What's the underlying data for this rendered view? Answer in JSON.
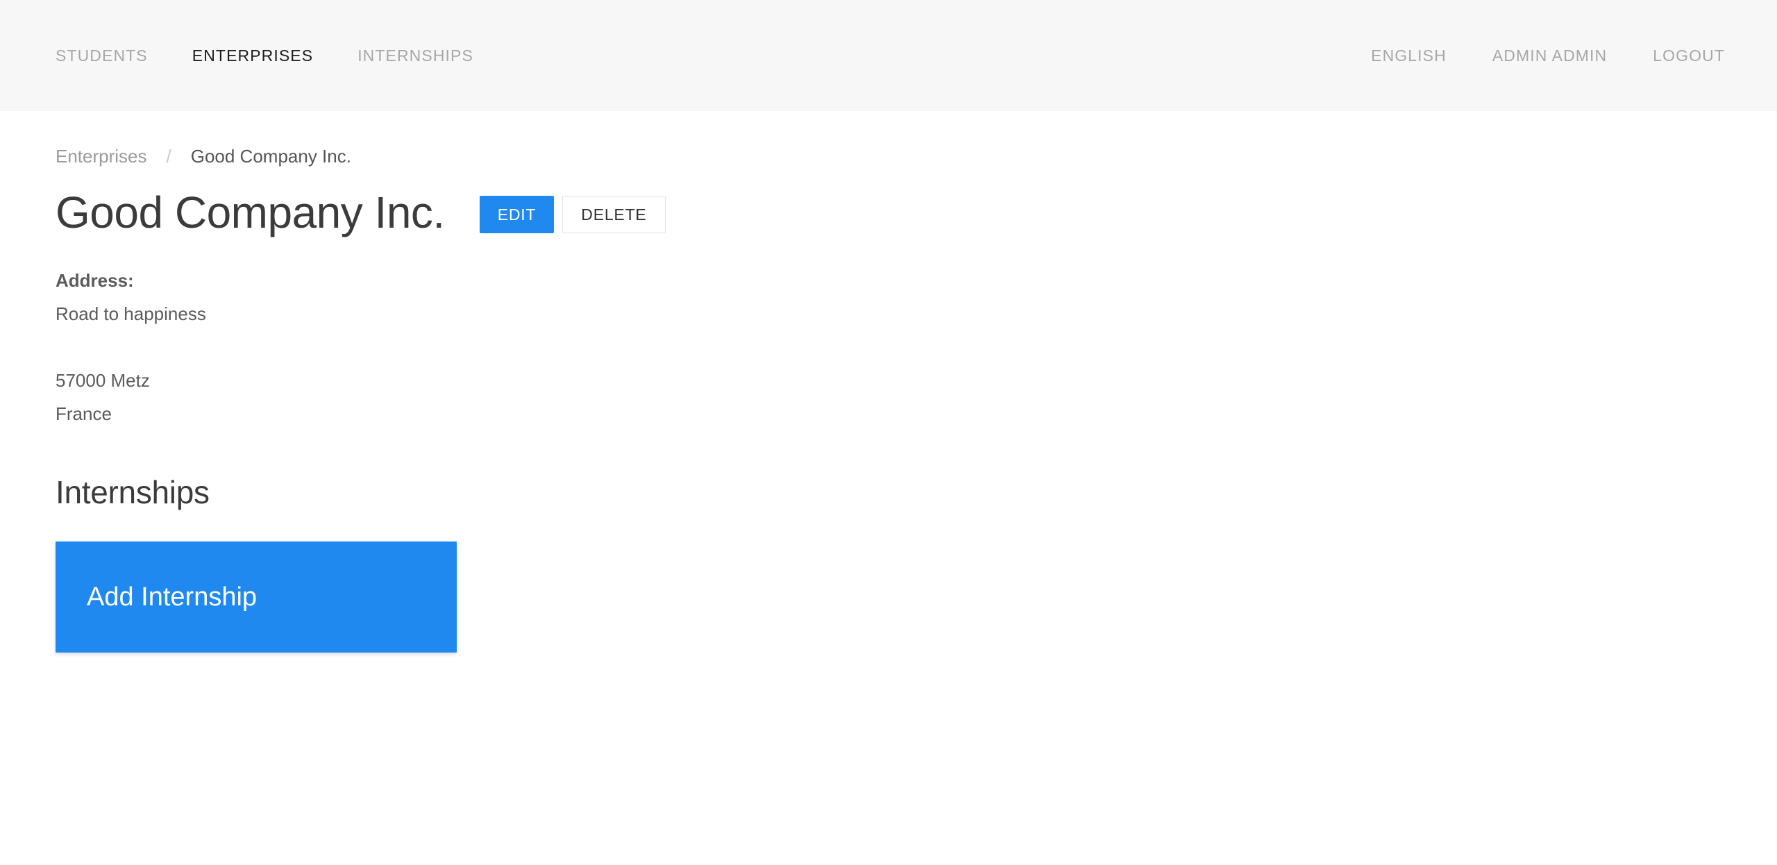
{
  "header": {
    "nav_left": [
      {
        "label": "Students",
        "active": false,
        "name": "nav-students"
      },
      {
        "label": "Enterprises",
        "active": true,
        "name": "nav-enterprises"
      },
      {
        "label": "Internships",
        "active": false,
        "name": "nav-internships"
      }
    ],
    "nav_right": [
      {
        "label": "English",
        "name": "nav-language"
      },
      {
        "label": "Admin Admin",
        "name": "nav-user"
      },
      {
        "label": "Logout",
        "name": "nav-logout"
      }
    ]
  },
  "breadcrumb": {
    "parent": "Enterprises",
    "separator": "/",
    "current": "Good Company Inc."
  },
  "enterprise": {
    "title": "Good Company Inc.",
    "edit_label": "EDIT",
    "delete_label": "DELETE",
    "address_label": "Address:",
    "address_street": "Road to happiness",
    "address_city": "57000 Metz",
    "address_country": "France"
  },
  "internships": {
    "section_title": "Internships",
    "add_label": "Add Internship"
  },
  "colors": {
    "accent": "#2089f0",
    "header_bg": "#f7f7f7",
    "page_bg": "#ffffff",
    "muted_text": "#a7a7a7",
    "body_text": "#5b5b5b",
    "heading_text": "#3b3b3b",
    "border": "#e2e2e2"
  }
}
